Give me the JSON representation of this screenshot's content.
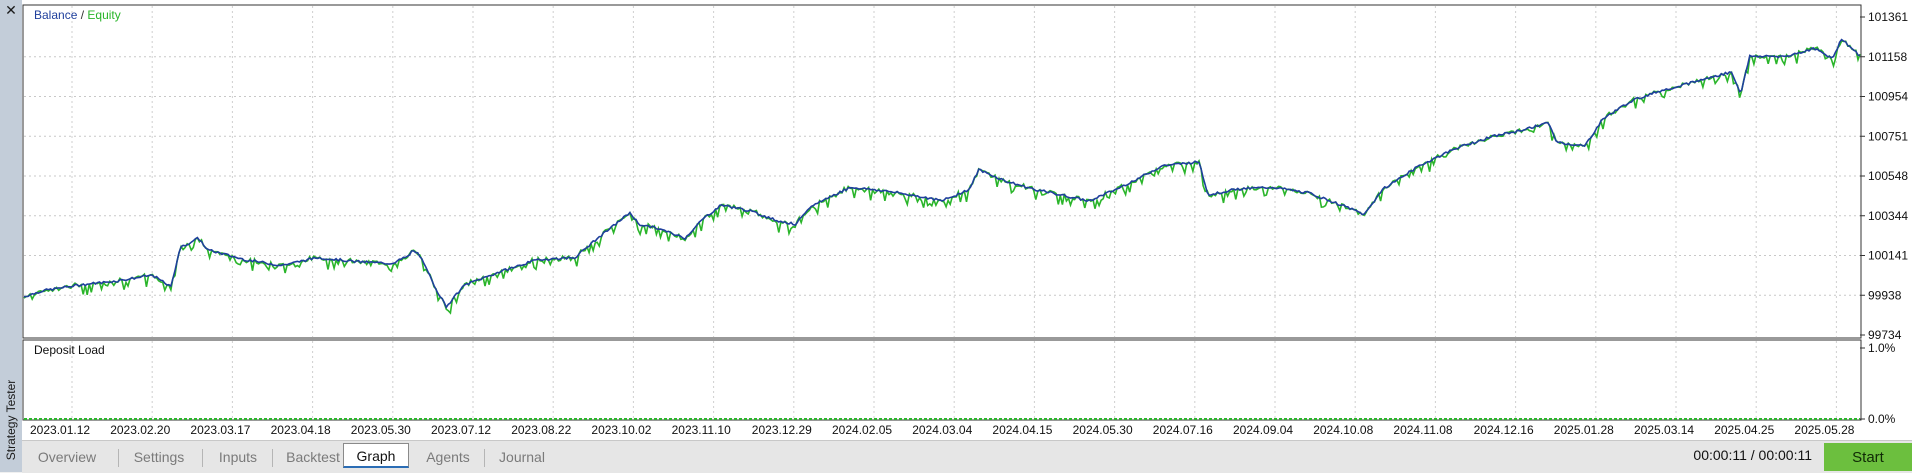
{
  "window": {
    "close_glyph": "✕",
    "side_title": "Strategy Tester"
  },
  "chart_data": [
    {
      "type": "line",
      "title": "Balance / Equity",
      "series": [
        {
          "name": "Balance",
          "color": "#1f3f9c"
        },
        {
          "name": "Equity",
          "color": "#2ab52a"
        }
      ],
      "y_ticks": [
        "101361",
        "101158",
        "100954",
        "100751",
        "100548",
        "100344",
        "100141",
        "99938",
        "99734"
      ],
      "ylim": [
        99734,
        101361
      ],
      "x_ticks": [
        "2023.01.12",
        "2023.02.20",
        "2023.03.17",
        "2023.04.18",
        "2023.05.30",
        "2023.07.12",
        "2023.08.22",
        "2023.10.02",
        "2023.11.10",
        "2023.12.29",
        "2024.02.05",
        "2024.03.04",
        "2024.04.15",
        "2024.05.30",
        "2024.07.16",
        "2024.09.04",
        "2024.10.08",
        "2024.11.08",
        "2024.12.16",
        "2025.01.28",
        "2025.03.14",
        "2025.04.25",
        "2025.05.28"
      ],
      "grid": true,
      "points": [
        [
          0,
          99930
        ],
        [
          0.01,
          99960
        ],
        [
          0.03,
          99990
        ],
        [
          0.05,
          100010
        ],
        [
          0.07,
          100040
        ],
        [
          0.08,
          99980
        ],
        [
          0.085,
          100180
        ],
        [
          0.095,
          100230
        ],
        [
          0.1,
          100170
        ],
        [
          0.12,
          100120
        ],
        [
          0.14,
          100090
        ],
        [
          0.16,
          100130
        ],
        [
          0.18,
          100110
        ],
        [
          0.2,
          100100
        ],
        [
          0.21,
          100140
        ],
        [
          0.205,
          100190
        ],
        [
          0.215,
          100150
        ],
        [
          0.225,
          99960
        ],
        [
          0.23,
          99880
        ],
        [
          0.24,
          99990
        ],
        [
          0.26,
          100060
        ],
        [
          0.28,
          100120
        ],
        [
          0.3,
          100130
        ],
        [
          0.31,
          100210
        ],
        [
          0.33,
          100360
        ],
        [
          0.335,
          100300
        ],
        [
          0.345,
          100280
        ],
        [
          0.36,
          100230
        ],
        [
          0.37,
          100330
        ],
        [
          0.38,
          100400
        ],
        [
          0.395,
          100370
        ],
        [
          0.41,
          100320
        ],
        [
          0.42,
          100300
        ],
        [
          0.43,
          100400
        ],
        [
          0.45,
          100490
        ],
        [
          0.47,
          100470
        ],
        [
          0.49,
          100440
        ],
        [
          0.5,
          100420
        ],
        [
          0.515,
          100480
        ],
        [
          0.52,
          100580
        ],
        [
          0.535,
          100520
        ],
        [
          0.55,
          100480
        ],
        [
          0.565,
          100450
        ],
        [
          0.58,
          100420
        ],
        [
          0.595,
          100480
        ],
        [
          0.61,
          100550
        ],
        [
          0.62,
          100600
        ],
        [
          0.64,
          100620
        ],
        [
          0.645,
          100450
        ],
        [
          0.66,
          100480
        ],
        [
          0.68,
          100490
        ],
        [
          0.7,
          100460
        ],
        [
          0.72,
          100390
        ],
        [
          0.73,
          100350
        ],
        [
          0.74,
          100480
        ],
        [
          0.76,
          100600
        ],
        [
          0.78,
          100690
        ],
        [
          0.8,
          100750
        ],
        [
          0.815,
          100780
        ],
        [
          0.83,
          100820
        ],
        [
          0.835,
          100720
        ],
        [
          0.85,
          100700
        ],
        [
          0.86,
          100840
        ],
        [
          0.875,
          100930
        ],
        [
          0.89,
          100980
        ],
        [
          0.91,
          101030
        ],
        [
          0.93,
          101080
        ],
        [
          0.935,
          100970
        ],
        [
          0.94,
          101160
        ],
        [
          0.96,
          101160
        ],
        [
          0.975,
          101200
        ],
        [
          0.985,
          101150
        ],
        [
          0.99,
          101250
        ],
        [
          1.0,
          101160
        ]
      ]
    },
    {
      "type": "line",
      "title": "Deposit Load",
      "y_ticks": [
        "1.0%",
        "0.0%"
      ],
      "ylim": [
        0,
        1
      ],
      "constant_value": 0
    }
  ],
  "tabs": [
    {
      "label": "Overview",
      "active": false
    },
    {
      "label": "Settings",
      "active": false
    },
    {
      "label": "Inputs",
      "active": false
    },
    {
      "label": "Backtest",
      "active": false
    },
    {
      "label": "Graph",
      "active": true
    },
    {
      "label": "Agents",
      "active": false
    },
    {
      "label": "Journal",
      "active": false
    }
  ],
  "status": {
    "timer": "00:00:11 / 00:00:11",
    "start_label": "Start"
  }
}
